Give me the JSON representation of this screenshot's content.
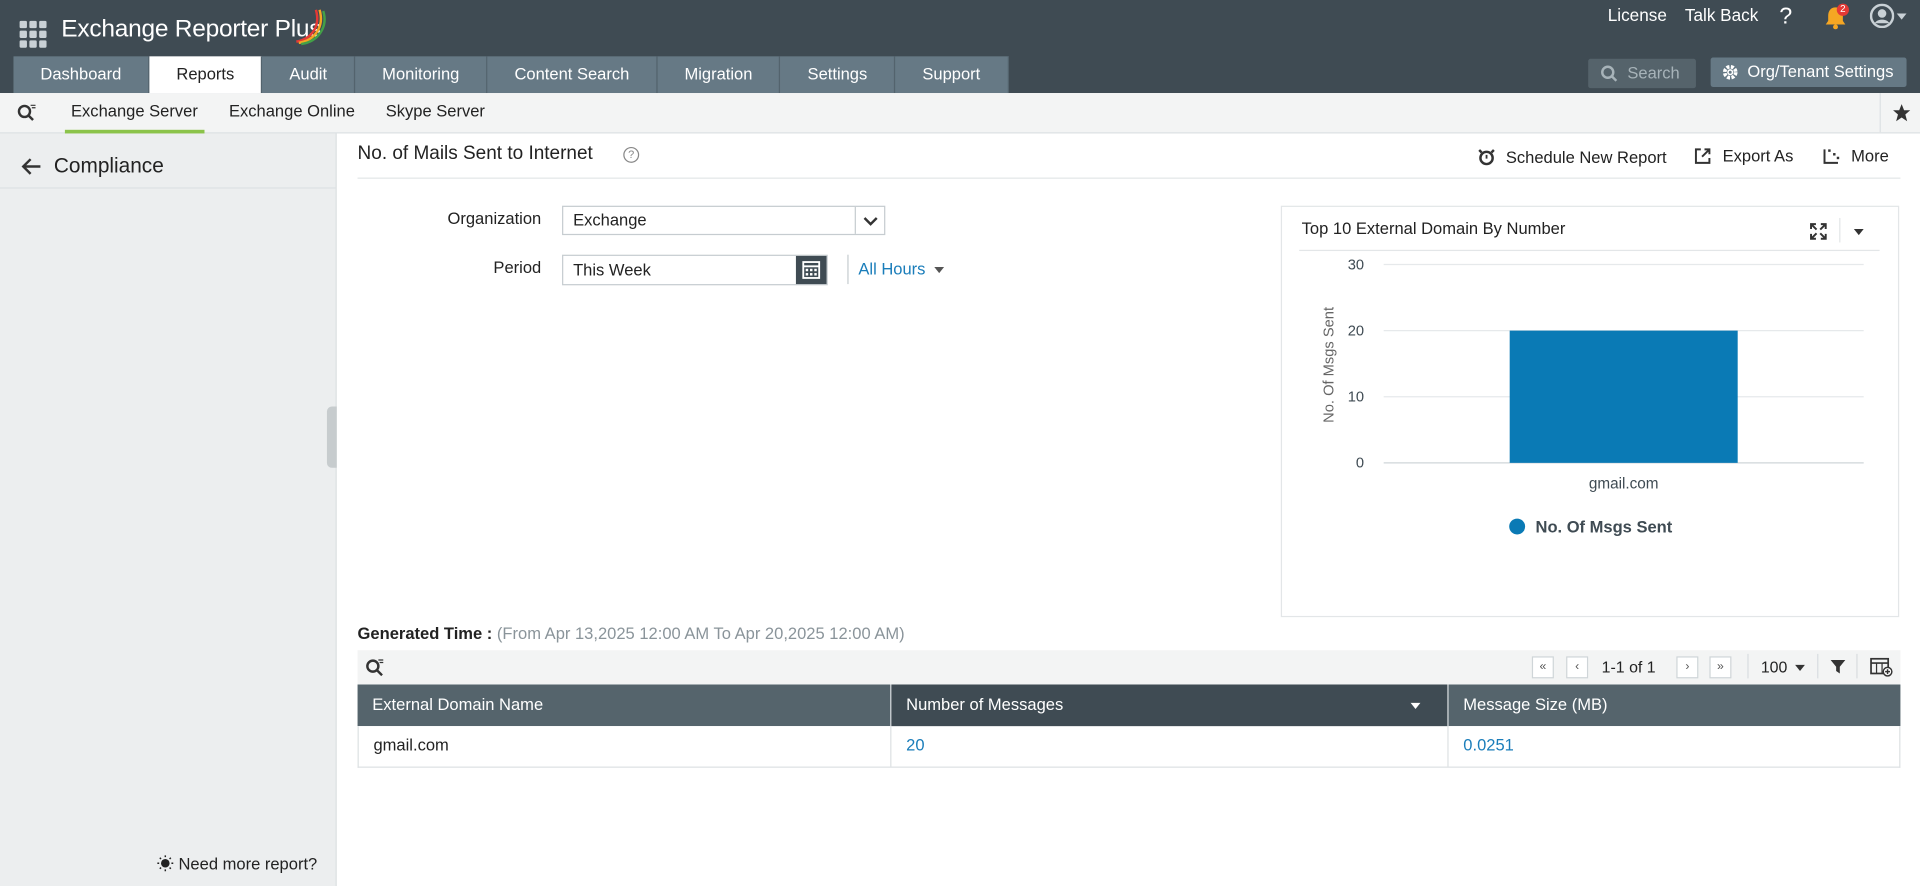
{
  "app": {
    "title": "Exchange Reporter Plus",
    "license": "License",
    "talkback": "Talk Back",
    "help": "?",
    "notif_count": "2"
  },
  "tabs": [
    "Dashboard",
    "Reports",
    "Audit",
    "Monitoring",
    "Content Search",
    "Migration",
    "Settings",
    "Support"
  ],
  "active_tab": "Reports",
  "search": {
    "placeholder": "Search"
  },
  "org_settings": "Org/Tenant Settings",
  "subtabs": [
    "Exchange Server",
    "Exchange Online",
    "Skype Server"
  ],
  "sidebar": {
    "section": "Compliance",
    "need_more": "Need more report?"
  },
  "report": {
    "title": "No. of Mails Sent to Internet",
    "actions": {
      "schedule": "Schedule New Report",
      "export": "Export As",
      "more": "More"
    },
    "org_label": "Organization",
    "org_value": "Exchange",
    "period_label": "Period",
    "period_value": "This Week",
    "hours": "All Hours",
    "generated_label": "Generated Time :",
    "generated_value": "(From Apr 13,2025 12:00 AM To Apr 20,2025 12:00 AM)"
  },
  "chart_data": {
    "type": "bar",
    "title": "Top 10 External Domain By Number",
    "categories": [
      "gmail.com"
    ],
    "series": [
      {
        "name": "No. Of Msgs Sent",
        "values": [
          20
        ]
      }
    ],
    "ylabel": "No. Of Msgs Sent",
    "ylim": [
      0,
      30
    ],
    "yticks": [
      0,
      10,
      20,
      30
    ],
    "grid": true,
    "legend": "bottom",
    "color": "#0a7ab5"
  },
  "table": {
    "pagination": "1-1 of 1",
    "page_size": "100",
    "columns": [
      "External Domain Name",
      "Number of Messages",
      "Message Size (MB)"
    ],
    "rows": [
      [
        "gmail.com",
        "20",
        "0.0251"
      ]
    ]
  },
  "colors": {
    "header": "#3f4b53",
    "tab": "#667985",
    "accent": "#8bc34a",
    "link": "#1a7dba",
    "bar": "#0a7ab5",
    "notif": "#f5a623"
  }
}
